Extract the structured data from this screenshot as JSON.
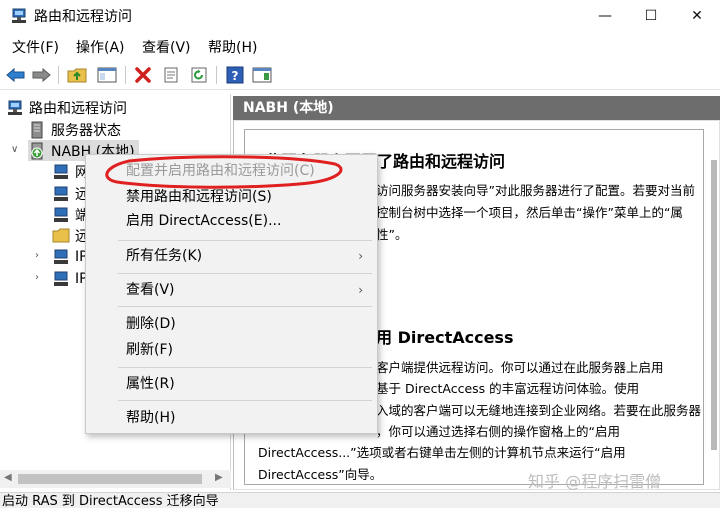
{
  "window": {
    "title": "路由和远程访问",
    "minimize": "—",
    "maximize": "☐",
    "close": "✕"
  },
  "menubar": {
    "items": [
      "文件(F)",
      "操作(A)",
      "查看(V)",
      "帮助(H)"
    ]
  },
  "tree": {
    "root": "路由和远程访问",
    "server_status": "服务器状态",
    "server": "NABH (本地)",
    "children": [
      "网",
      "远",
      "端",
      "远",
      "IP",
      "IP"
    ]
  },
  "right_pane": {
    "header": "NABH (本地)",
    "heading1": "此服务器上配置了路由和远程访问",
    "para1": [
      "访问服务器安装向导”对此服务器进行了配置。若要对当前",
      "控制台树中选择一个项目，然后单击“操作”菜单上的“属",
      "性”。"
    ],
    "heading2": "用 DirectAccess",
    "para2": [
      "客户端提供远程访问。你可以通过在此服务器上启用",
      "基于 DirectAccess 的丰富远程访问体验。使用",
      "入域的客户端可以无缝地连接到企业网络。若要在此服务器",
      "，你可以通过选择右侧的操作窗格上的“启用",
      "DirectAccess...”选项或者右键单击左侧的计算机节点来运行“启用",
      "DirectAccess”向导。"
    ]
  },
  "context_menu": {
    "configure": "配置并启用路由和远程访问(C)",
    "disable": "禁用路由和远程访问(S)",
    "enable_da": "启用 DirectAccess(E)...",
    "all_tasks": "所有任务(K)",
    "view": "查看(V)",
    "delete": "删除(D)",
    "refresh": "刷新(F)",
    "properties": "属性(R)",
    "help": "帮助(H)",
    "submenu_arrow": "›"
  },
  "statusbar": {
    "text": "启动 RAS 到 DirectAccess 迁移向导"
  },
  "watermark": "知乎 @程序扫雷僧",
  "colors": {
    "header_bg": "#6d6d6d",
    "annotation_red": "#e02020",
    "menu_bg": "#f2f2f2"
  }
}
